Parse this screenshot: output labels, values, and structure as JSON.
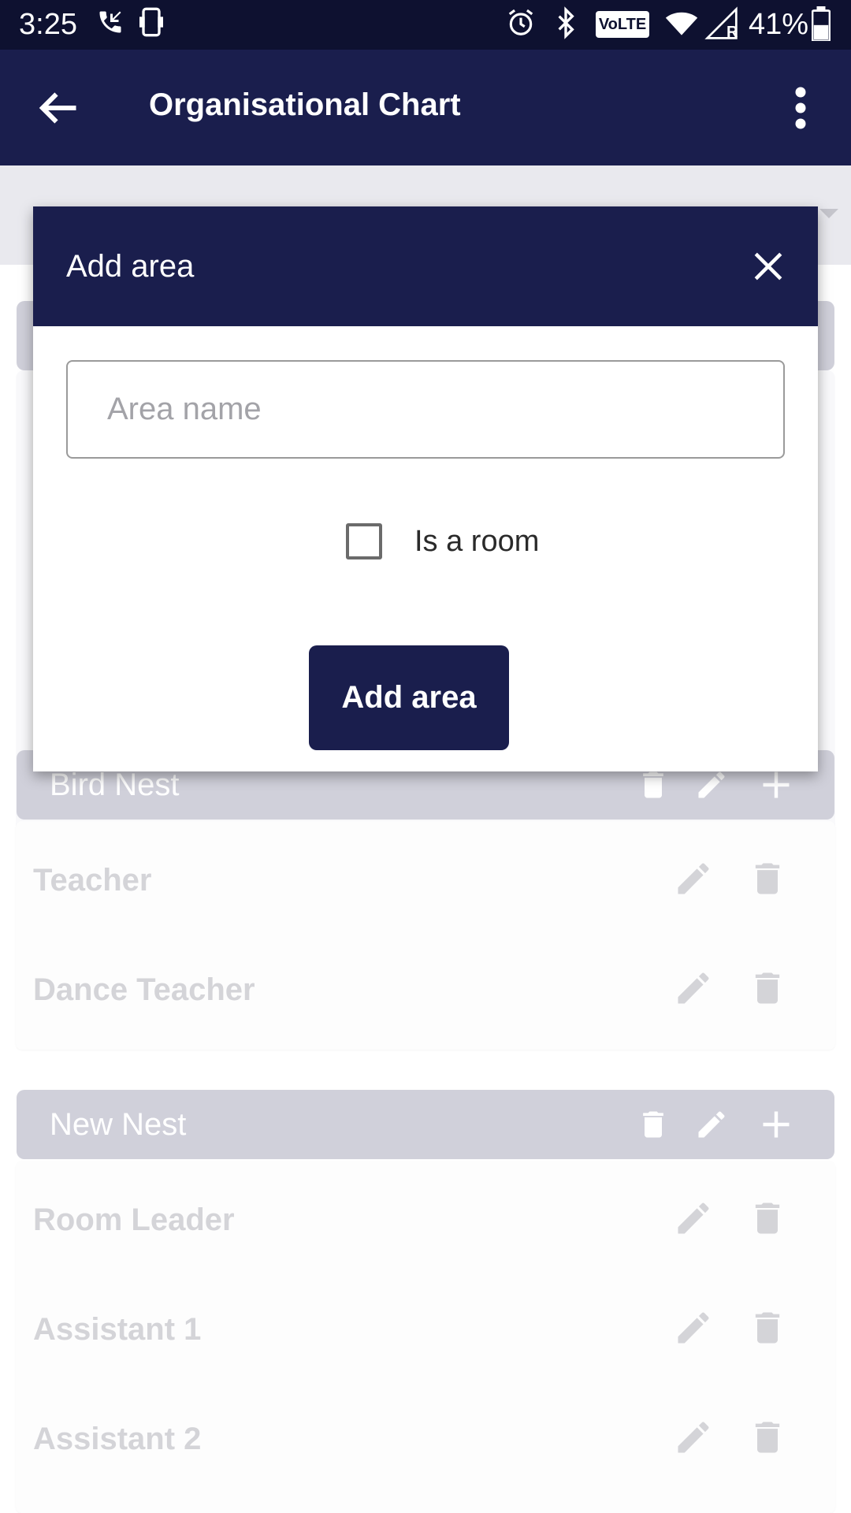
{
  "status_bar": {
    "time": "3:25",
    "battery": "41%",
    "volte": "VoLTE",
    "roaming": "R",
    "icons": [
      "missed-call-icon",
      "device-icon",
      "alarm-icon",
      "bluetooth-icon",
      "volte-icon",
      "wifi-icon",
      "signal-icon",
      "battery-icon"
    ]
  },
  "app_bar": {
    "title": "Organisational Chart",
    "back_icon": "arrow-left-icon",
    "menu_icon": "more-vertical-icon"
  },
  "background": {
    "areas": [
      {
        "name": "Bird Nest",
        "roles": [
          "Teacher",
          "Dance Teacher"
        ]
      },
      {
        "name": "New Nest",
        "roles": [
          "Room Leader",
          "Assistant 1",
          "Assistant 2"
        ]
      }
    ]
  },
  "dialog": {
    "title": "Add area",
    "close_icon": "close-icon",
    "name_placeholder": "Area name",
    "name_value": "",
    "checkbox_label": "Is a room",
    "checkbox_checked": false,
    "submit_label": "Add area"
  },
  "colors": {
    "primary": "#1a1e4d",
    "status_bar": "#0e1130",
    "area_header": "#d0d0da",
    "muted_text": "#d4d4d8"
  }
}
